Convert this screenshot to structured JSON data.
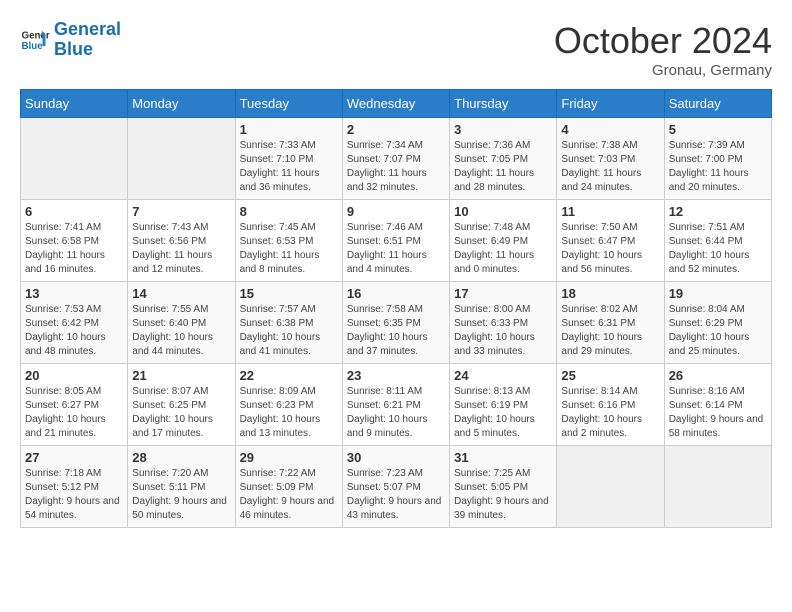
{
  "header": {
    "logo_line1": "General",
    "logo_line2": "Blue",
    "month": "October 2024",
    "location": "Gronau, Germany"
  },
  "weekdays": [
    "Sunday",
    "Monday",
    "Tuesday",
    "Wednesday",
    "Thursday",
    "Friday",
    "Saturday"
  ],
  "weeks": [
    [
      {
        "day": "",
        "info": ""
      },
      {
        "day": "",
        "info": ""
      },
      {
        "day": "1",
        "info": "Sunrise: 7:33 AM\nSunset: 7:10 PM\nDaylight: 11 hours and 36 minutes."
      },
      {
        "day": "2",
        "info": "Sunrise: 7:34 AM\nSunset: 7:07 PM\nDaylight: 11 hours and 32 minutes."
      },
      {
        "day": "3",
        "info": "Sunrise: 7:36 AM\nSunset: 7:05 PM\nDaylight: 11 hours and 28 minutes."
      },
      {
        "day": "4",
        "info": "Sunrise: 7:38 AM\nSunset: 7:03 PM\nDaylight: 11 hours and 24 minutes."
      },
      {
        "day": "5",
        "info": "Sunrise: 7:39 AM\nSunset: 7:00 PM\nDaylight: 11 hours and 20 minutes."
      }
    ],
    [
      {
        "day": "6",
        "info": "Sunrise: 7:41 AM\nSunset: 6:58 PM\nDaylight: 11 hours and 16 minutes."
      },
      {
        "day": "7",
        "info": "Sunrise: 7:43 AM\nSunset: 6:56 PM\nDaylight: 11 hours and 12 minutes."
      },
      {
        "day": "8",
        "info": "Sunrise: 7:45 AM\nSunset: 6:53 PM\nDaylight: 11 hours and 8 minutes."
      },
      {
        "day": "9",
        "info": "Sunrise: 7:46 AM\nSunset: 6:51 PM\nDaylight: 11 hours and 4 minutes."
      },
      {
        "day": "10",
        "info": "Sunrise: 7:48 AM\nSunset: 6:49 PM\nDaylight: 11 hours and 0 minutes."
      },
      {
        "day": "11",
        "info": "Sunrise: 7:50 AM\nSunset: 6:47 PM\nDaylight: 10 hours and 56 minutes."
      },
      {
        "day": "12",
        "info": "Sunrise: 7:51 AM\nSunset: 6:44 PM\nDaylight: 10 hours and 52 minutes."
      }
    ],
    [
      {
        "day": "13",
        "info": "Sunrise: 7:53 AM\nSunset: 6:42 PM\nDaylight: 10 hours and 48 minutes."
      },
      {
        "day": "14",
        "info": "Sunrise: 7:55 AM\nSunset: 6:40 PM\nDaylight: 10 hours and 44 minutes."
      },
      {
        "day": "15",
        "info": "Sunrise: 7:57 AM\nSunset: 6:38 PM\nDaylight: 10 hours and 41 minutes."
      },
      {
        "day": "16",
        "info": "Sunrise: 7:58 AM\nSunset: 6:35 PM\nDaylight: 10 hours and 37 minutes."
      },
      {
        "day": "17",
        "info": "Sunrise: 8:00 AM\nSunset: 6:33 PM\nDaylight: 10 hours and 33 minutes."
      },
      {
        "day": "18",
        "info": "Sunrise: 8:02 AM\nSunset: 6:31 PM\nDaylight: 10 hours and 29 minutes."
      },
      {
        "day": "19",
        "info": "Sunrise: 8:04 AM\nSunset: 6:29 PM\nDaylight: 10 hours and 25 minutes."
      }
    ],
    [
      {
        "day": "20",
        "info": "Sunrise: 8:05 AM\nSunset: 6:27 PM\nDaylight: 10 hours and 21 minutes."
      },
      {
        "day": "21",
        "info": "Sunrise: 8:07 AM\nSunset: 6:25 PM\nDaylight: 10 hours and 17 minutes."
      },
      {
        "day": "22",
        "info": "Sunrise: 8:09 AM\nSunset: 6:23 PM\nDaylight: 10 hours and 13 minutes."
      },
      {
        "day": "23",
        "info": "Sunrise: 8:11 AM\nSunset: 6:21 PM\nDaylight: 10 hours and 9 minutes."
      },
      {
        "day": "24",
        "info": "Sunrise: 8:13 AM\nSunset: 6:19 PM\nDaylight: 10 hours and 5 minutes."
      },
      {
        "day": "25",
        "info": "Sunrise: 8:14 AM\nSunset: 6:16 PM\nDaylight: 10 hours and 2 minutes."
      },
      {
        "day": "26",
        "info": "Sunrise: 8:16 AM\nSunset: 6:14 PM\nDaylight: 9 hours and 58 minutes."
      }
    ],
    [
      {
        "day": "27",
        "info": "Sunrise: 7:18 AM\nSunset: 5:12 PM\nDaylight: 9 hours and 54 minutes."
      },
      {
        "day": "28",
        "info": "Sunrise: 7:20 AM\nSunset: 5:11 PM\nDaylight: 9 hours and 50 minutes."
      },
      {
        "day": "29",
        "info": "Sunrise: 7:22 AM\nSunset: 5:09 PM\nDaylight: 9 hours and 46 minutes."
      },
      {
        "day": "30",
        "info": "Sunrise: 7:23 AM\nSunset: 5:07 PM\nDaylight: 9 hours and 43 minutes."
      },
      {
        "day": "31",
        "info": "Sunrise: 7:25 AM\nSunset: 5:05 PM\nDaylight: 9 hours and 39 minutes."
      },
      {
        "day": "",
        "info": ""
      },
      {
        "day": "",
        "info": ""
      }
    ]
  ]
}
